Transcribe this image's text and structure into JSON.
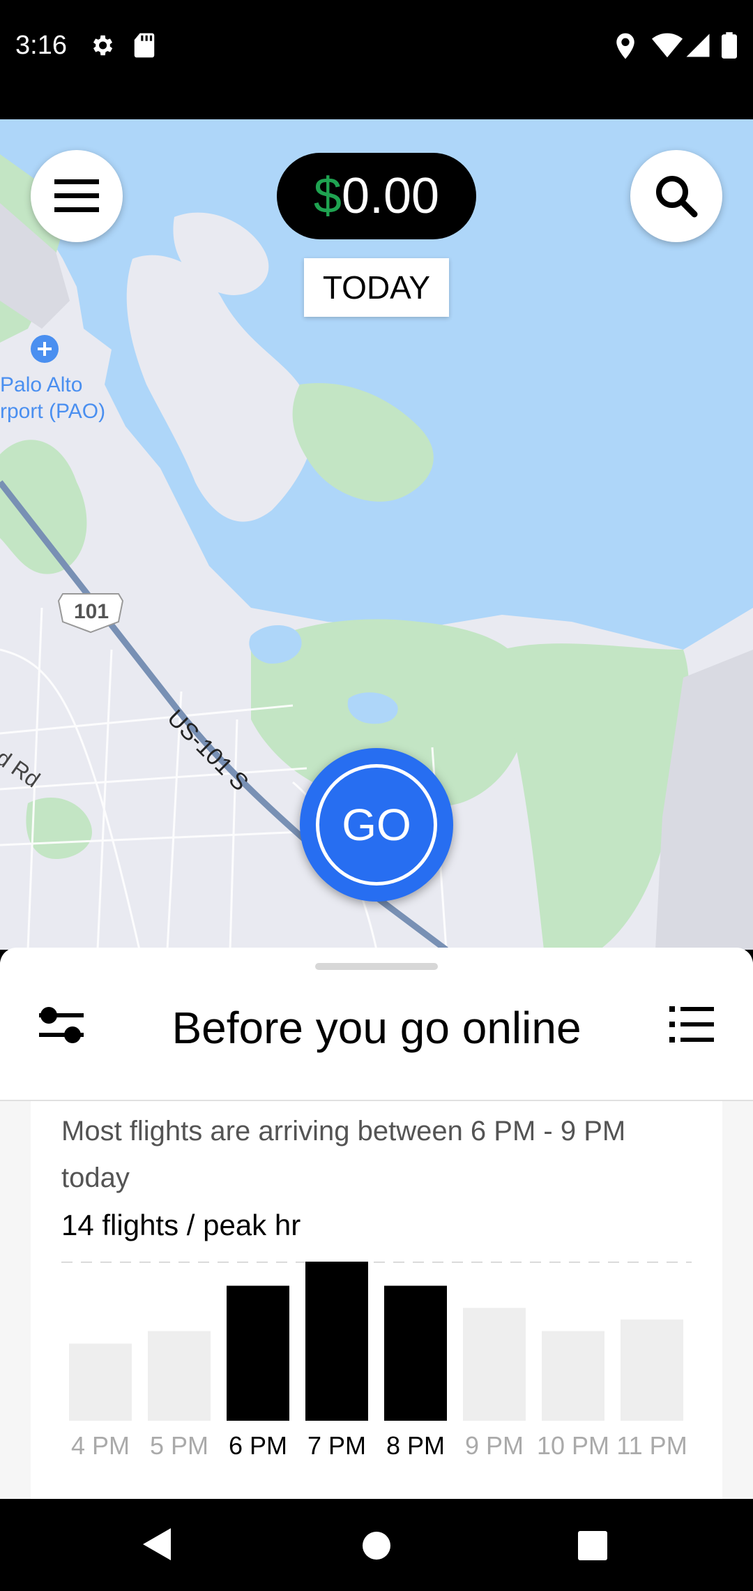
{
  "status_bar": {
    "time": "3:16",
    "left_icons": [
      "gear-icon",
      "sd-card-icon"
    ],
    "right_icons": [
      "location-icon",
      "wifi-icon",
      "cell-signal-icon",
      "battery-icon"
    ]
  },
  "map": {
    "labels": {
      "airport": [
        "Palo Alto",
        "rport (PAO)"
      ],
      "highway_shield": "101",
      "highway_name": "US-101 S",
      "road": "d Rd"
    }
  },
  "header": {
    "menu_icon": "hamburger-icon",
    "search_icon": "search-icon",
    "earnings_symbol": "$",
    "earnings_value": "0.00",
    "period_label": "TODAY"
  },
  "go_button": {
    "label": "GO"
  },
  "sheet": {
    "title": "Before you go online",
    "left_icon": "sliders-icon",
    "right_icon": "list-icon"
  },
  "flights_card": {
    "description": "Most flights are arriving between 6 PM - 9 PM today",
    "peak_label": "14 flights / peak hr"
  },
  "chart_data": {
    "type": "bar",
    "categories": [
      "4 PM",
      "5 PM",
      "6 PM",
      "7 PM",
      "8 PM",
      "9 PM",
      "10 PM",
      "11 PM"
    ],
    "values": [
      8,
      9.3,
      14,
      16.5,
      14,
      11.7,
      9.3,
      10.5
    ],
    "highlighted": [
      "6 PM",
      "7 PM",
      "8 PM"
    ],
    "peak_line": 14,
    "ylim": [
      0,
      16.5
    ],
    "colors": {
      "highlight": "#000000",
      "normal": "#eeeeee",
      "highlight_label": "#000000",
      "normal_label": "#aaaaaa"
    }
  },
  "nav_bar": {
    "icons": [
      "back-icon",
      "home-icon",
      "recents-icon"
    ]
  }
}
